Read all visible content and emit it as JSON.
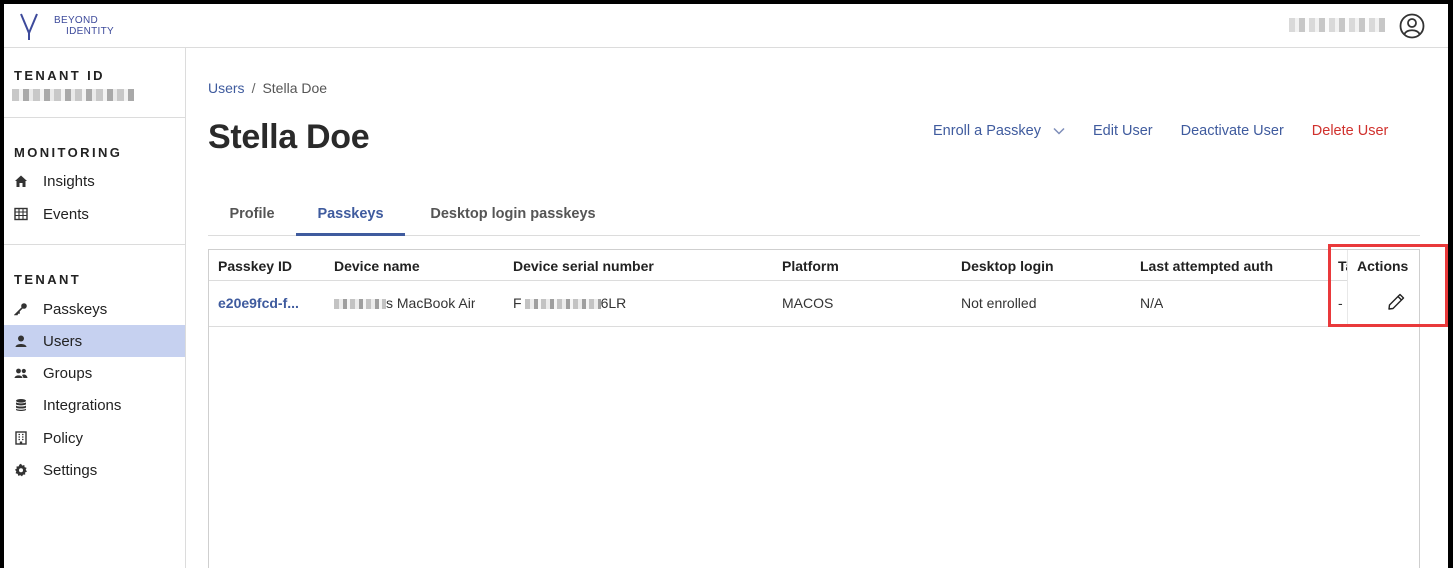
{
  "brand": {
    "logo_line1": "BEYOND",
    "logo_line2": "IDENTITY"
  },
  "header": {
    "user_name": "",
    "avatar_icon": "user-circle-icon"
  },
  "sidebar": {
    "tenant_heading": "TENANT ID",
    "tenant_id_value": "",
    "monitoring_heading": "MONITORING",
    "monitoring_items": [
      {
        "label": "Insights",
        "icon": "home-icon"
      },
      {
        "label": "Events",
        "icon": "table-icon"
      }
    ],
    "tenant_section_heading": "TENANT",
    "tenant_items": [
      {
        "label": "Passkeys",
        "icon": "key-icon"
      },
      {
        "label": "Users",
        "icon": "user-icon",
        "active": true
      },
      {
        "label": "Groups",
        "icon": "group-icon"
      },
      {
        "label": "Integrations",
        "icon": "database-icon"
      },
      {
        "label": "Policy",
        "icon": "building-icon"
      },
      {
        "label": "Settings",
        "icon": "gear-icon"
      }
    ]
  },
  "breadcrumb": {
    "parent": "Users",
    "separator": "/",
    "current": "Stella Doe"
  },
  "page": {
    "title": "Stella Doe"
  },
  "actions": {
    "enroll": "Enroll a Passkey",
    "edit": "Edit User",
    "deactivate": "Deactivate User",
    "delete": "Delete User"
  },
  "tabs": [
    {
      "label": "Profile",
      "active": false
    },
    {
      "label": "Passkeys",
      "active": true
    },
    {
      "label": "Desktop login passkeys",
      "active": false
    }
  ],
  "table": {
    "columns": [
      "Passkey ID",
      "Device name",
      "Device serial number",
      "Platform",
      "Desktop login",
      "Last attempted auth",
      "Ta",
      "Actions"
    ],
    "rows": [
      {
        "passkey_id": "e20e9fcd-f...",
        "device_name_suffix": "s MacBook Air",
        "serial_prefix": "F",
        "serial_suffix": "6LR",
        "platform": "MACOS",
        "desktop_login": "Not enrolled",
        "last_auth": "N/A",
        "truncated": "-",
        "action_icon": "pencil-icon"
      }
    ]
  },
  "colors": {
    "accent": "#3f5b9e",
    "danger": "#d0312d",
    "active_nav": "#c6d1f0",
    "highlight": "#e9393b"
  }
}
